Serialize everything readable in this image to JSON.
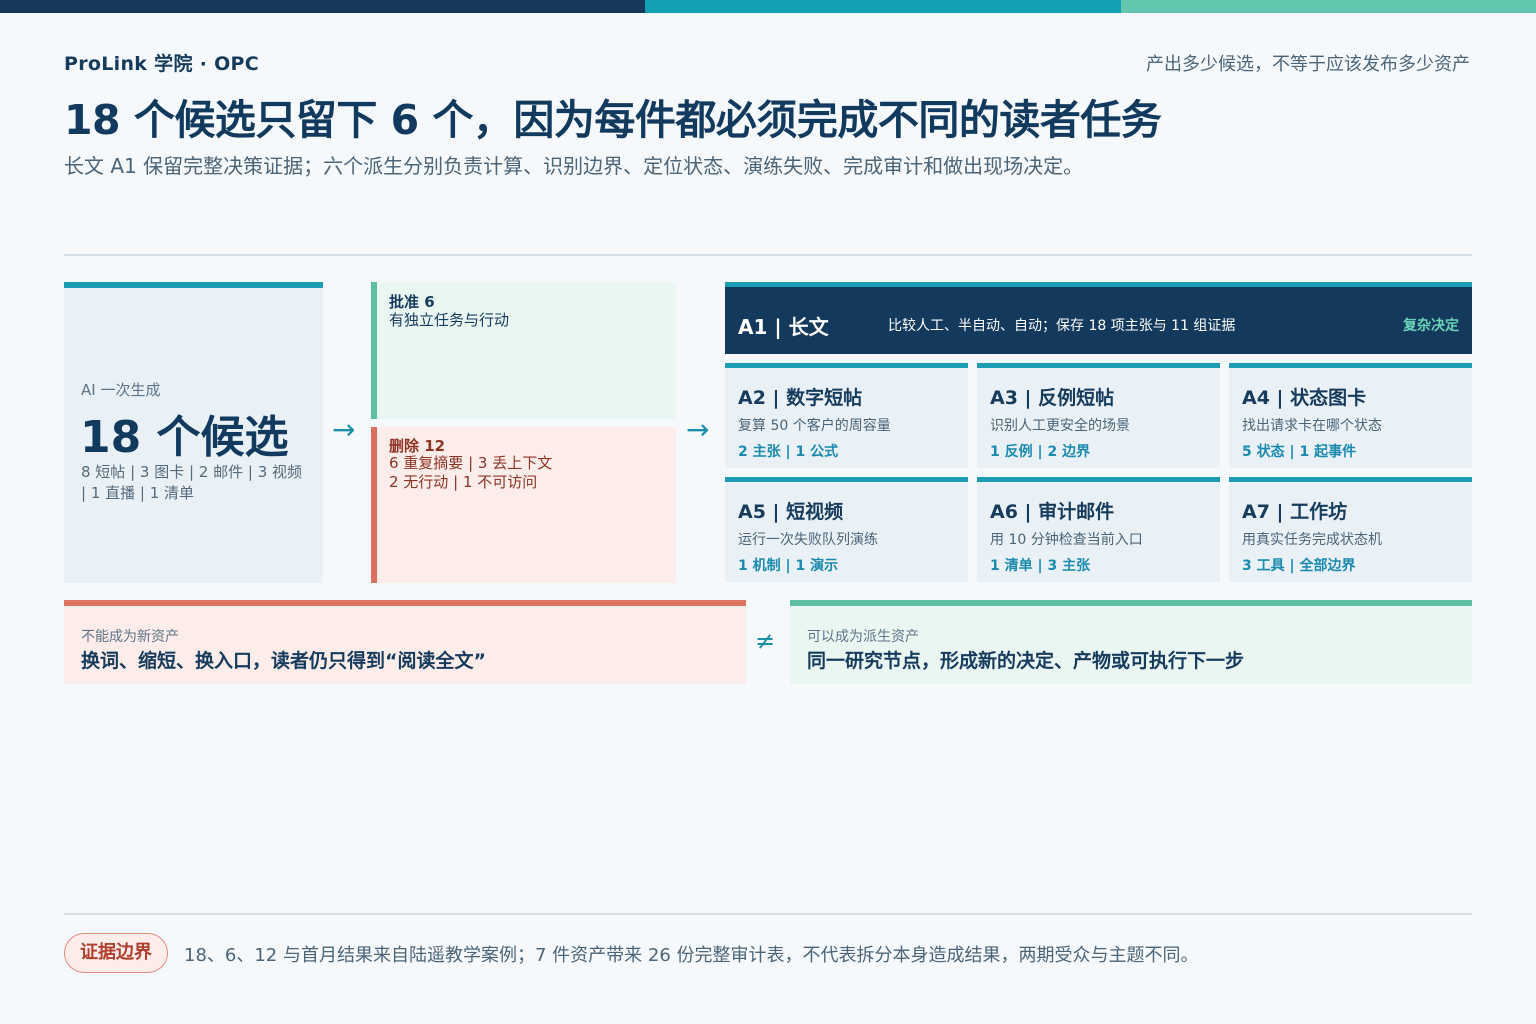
{
  "header": {
    "brand": "ProLink 学院 · OPC",
    "tagline": "产出多少候选，不等于应该发布多少资产",
    "title": "18 个候选只留下 6 个，因为每件都必须完成不同的读者任务",
    "subtitle": "长文 A1 保留完整决策证据；六个派生分别负责计算、识别边界、定位状态、演练失败、完成审计和做出现场决定。"
  },
  "candidates": {
    "label": "AI 一次生成",
    "headline": "18 个候选",
    "detail": "8 短帖 | 3 图卡 | 2 邮件 | 3 视频 | 1 直播 | 1 清单"
  },
  "arrow_glyph": "→",
  "approved": {
    "heading": "批准 6",
    "text": "有独立任务与行动"
  },
  "deleted": {
    "heading": "删除 12",
    "line1": "6 重复摘要 | 3 丢上下文",
    "line2": "2 无行动 | 1 不可访问"
  },
  "main_asset": {
    "name": "A1 | 长文",
    "desc": "比较人工、半自动、自动；保存 18 项主张与 11 组证据",
    "tag": "复杂决定"
  },
  "assets": [
    {
      "name": "A2 | 数字短帖",
      "desc": "复算 50 个客户的周容量",
      "meta": "2 主张 | 1 公式"
    },
    {
      "name": "A3 | 反例短帖",
      "desc": "识别人工更安全的场景",
      "meta": "1 反例 | 2 边界"
    },
    {
      "name": "A4 | 状态图卡",
      "desc": "找出请求卡在哪个状态",
      "meta": "5 状态 | 1 起事件"
    },
    {
      "name": "A5 | 短视频",
      "desc": "运行一次失败队列演练",
      "meta": "1 机制 | 1 演示"
    },
    {
      "name": "A6 | 审计邮件",
      "desc": "用 10 分钟检查当前入口",
      "meta": "1 清单 | 3 主张"
    },
    {
      "name": "A7 | 工作坊",
      "desc": "用真实任务完成状态机",
      "meta": "3 工具 | 全部边界"
    }
  ],
  "contrast": {
    "cannot_label": "不能成为新资产",
    "cannot_text": "换词、缩短、换入口，读者仍只得到“阅读全文”",
    "neq_glyph": "≠",
    "can_label": "可以成为派生资产",
    "can_text": "同一研究节点，形成新的决定、产物或可执行下一步"
  },
  "footer": {
    "pill": "证据边界",
    "text": "18、6、12 与首月结果来自陆遥教学案例；7 件资产带来 26 份完整审计表，不代表拆分本身造成结果，两期受众与主题不同。"
  },
  "colors": {
    "navy": "#13395C",
    "teal": "#1C9DB4",
    "mint": "#5CBFA4",
    "coral": "#D9705F"
  }
}
